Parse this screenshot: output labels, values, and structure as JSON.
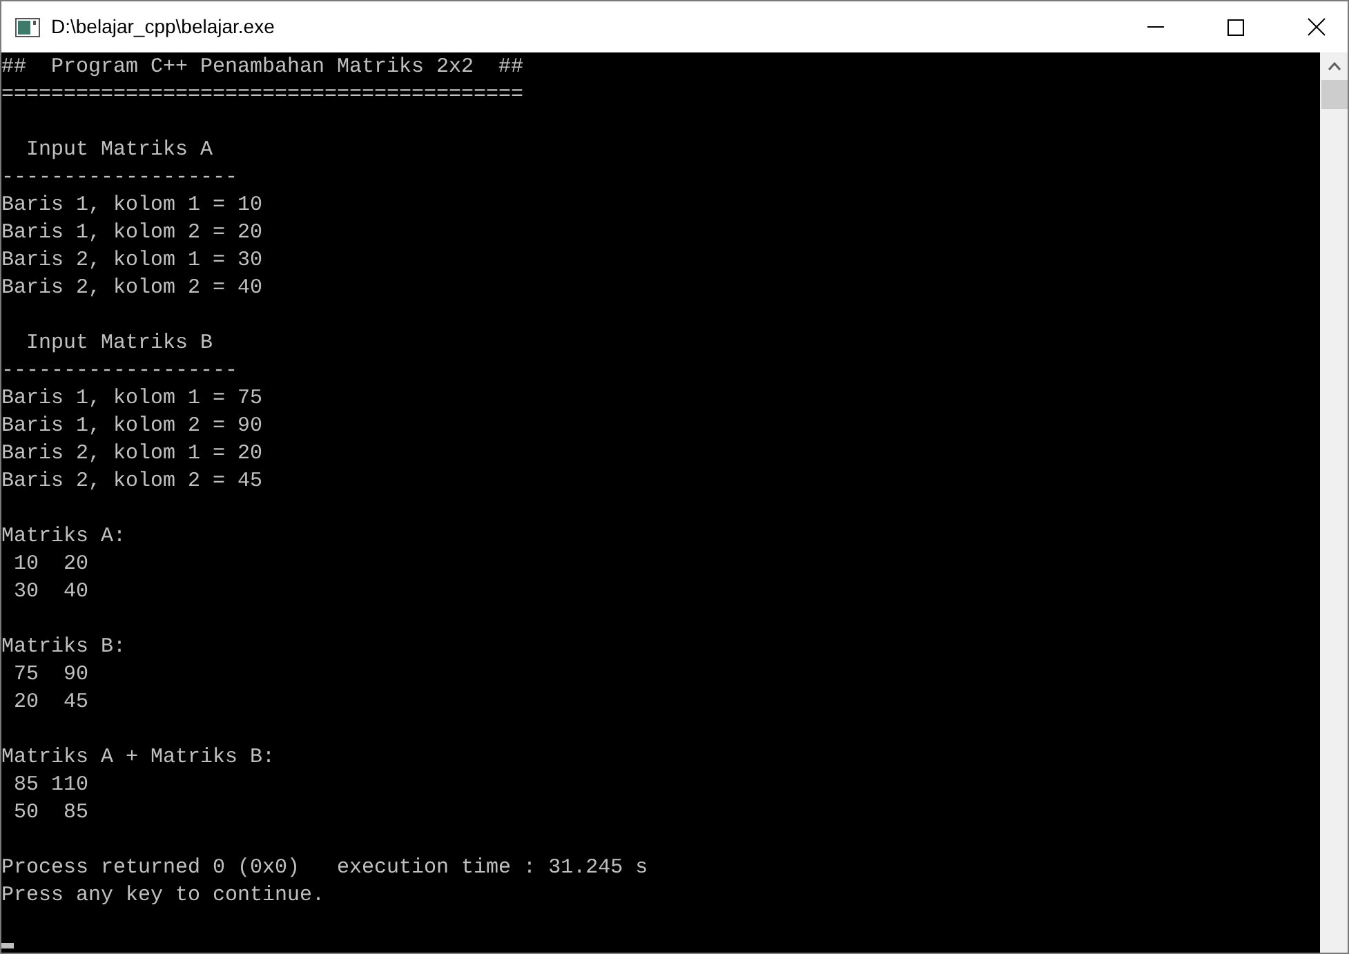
{
  "window": {
    "title": "D:\\belajar_cpp\\belajar.exe"
  },
  "console": {
    "blocks": [
      [
        "##  Program C++ Penambahan Matriks 2x2  ##",
        "=========================================="
      ],
      [
        "  Input Matriks A",
        "-------------------",
        "Baris 1, kolom 1 = 10",
        "Baris 1, kolom 2 = 20",
        "Baris 2, kolom 1 = 30",
        "Baris 2, kolom 2 = 40"
      ],
      [
        "  Input Matriks B",
        "-------------------",
        "Baris 1, kolom 1 = 75",
        "Baris 1, kolom 2 = 90",
        "Baris 2, kolom 1 = 20",
        "Baris 2, kolom 2 = 45"
      ],
      [
        "Matriks A:",
        " 10  20",
        " 30  40"
      ],
      [
        "Matriks B:",
        " 75  90",
        " 20  45"
      ],
      [
        "Matriks A + Matriks B:",
        " 85 110",
        " 50  85"
      ],
      [
        "Process returned 0 (0x0)   execution time : 31.245 s",
        "Press any key to continue."
      ]
    ]
  }
}
